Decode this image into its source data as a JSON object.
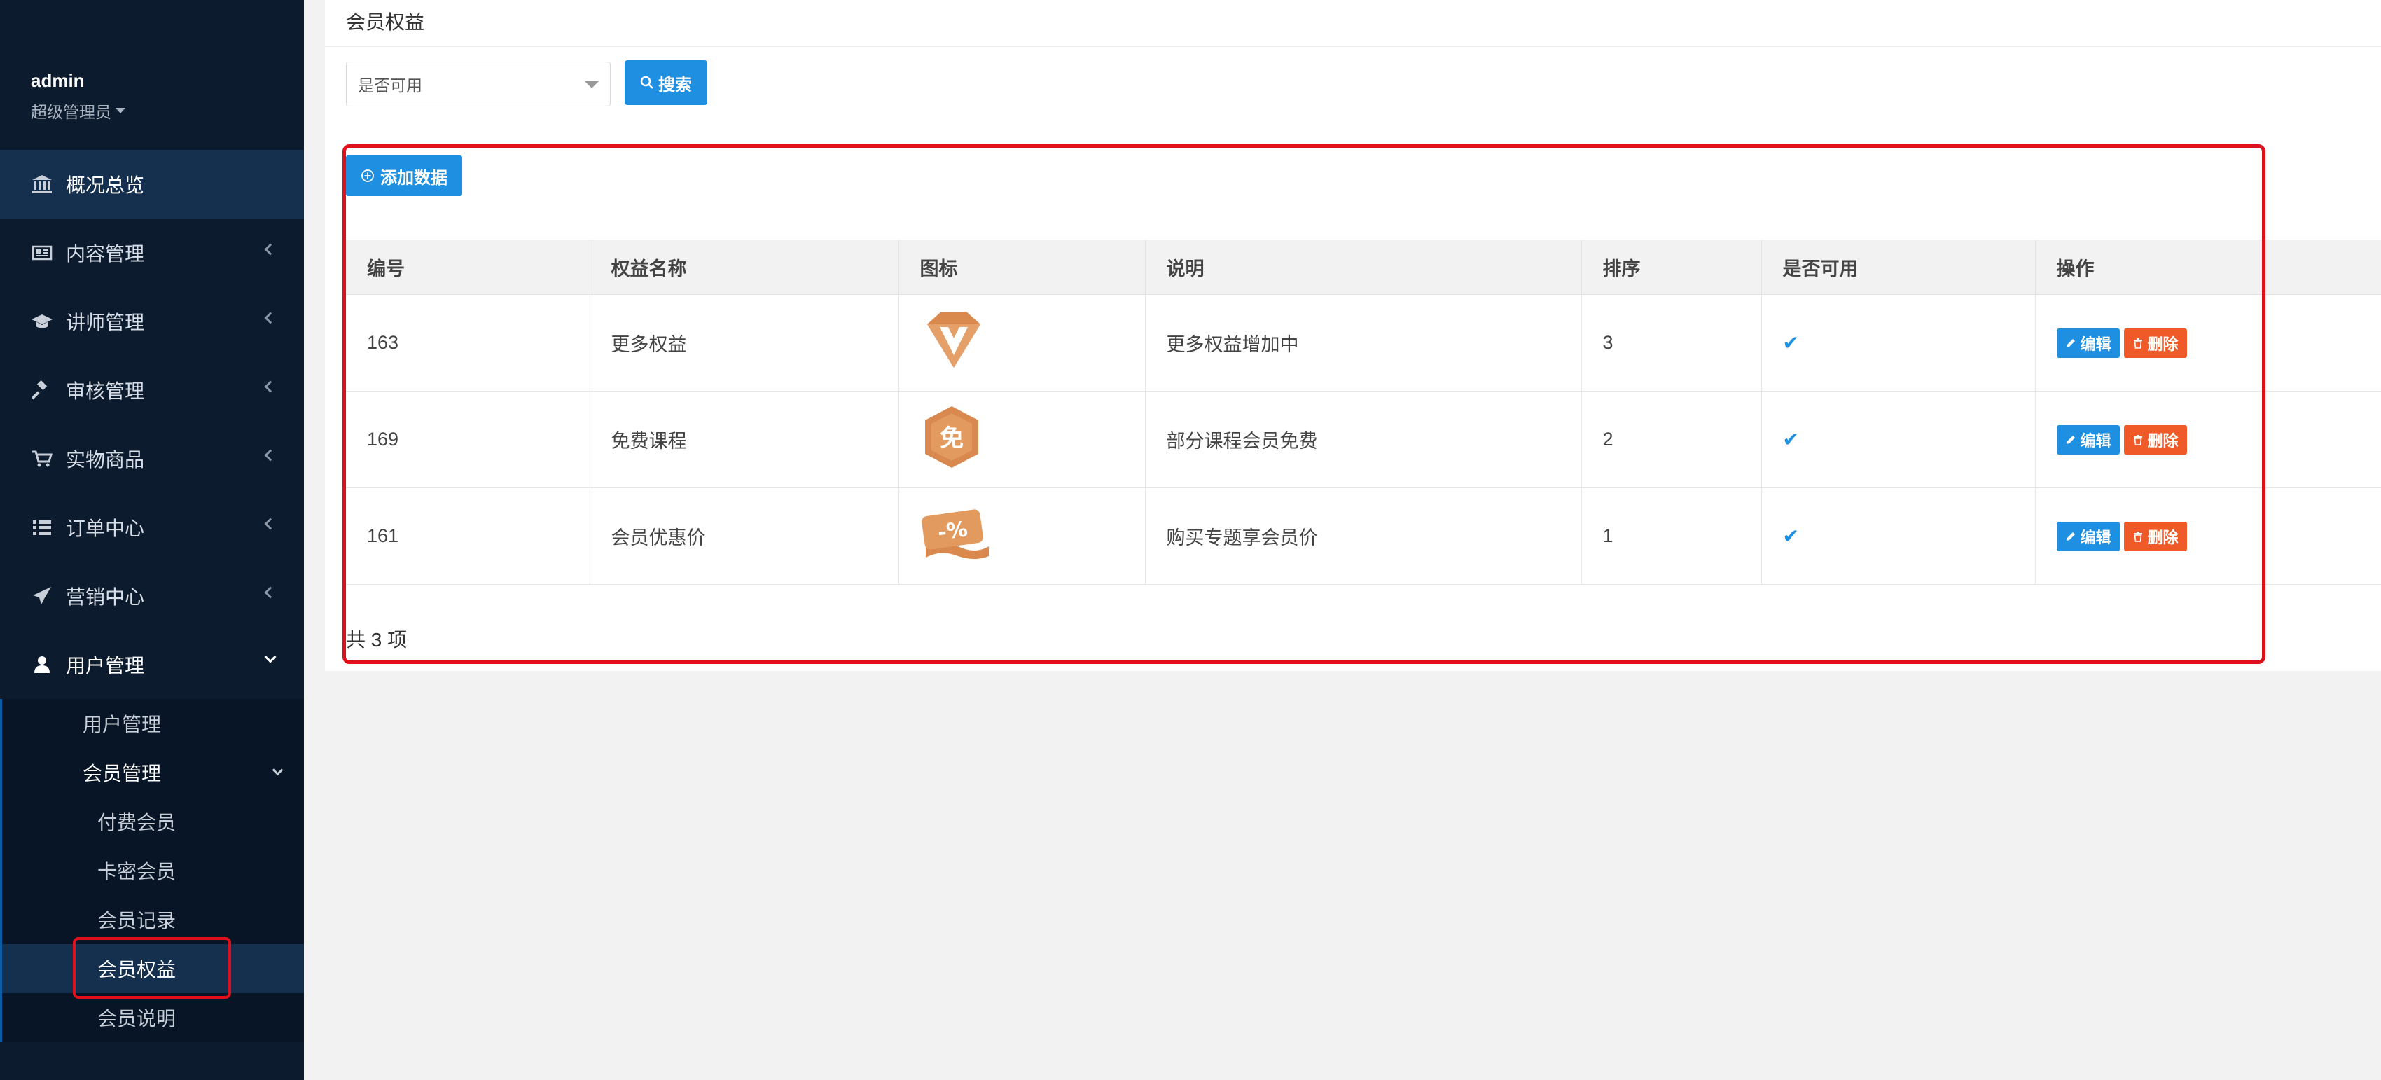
{
  "user": {
    "name": "admin",
    "role": "超级管理员"
  },
  "menu": [
    {
      "label": "概况总览",
      "icon": "bank-icon"
    },
    {
      "label": "内容管理",
      "icon": "newspaper-icon"
    },
    {
      "label": "讲师管理",
      "icon": "graduation-cap-icon"
    },
    {
      "label": "审核管理",
      "icon": "gavel-icon"
    },
    {
      "label": "实物商品",
      "icon": "cart-icon"
    },
    {
      "label": "订单中心",
      "icon": "list-icon"
    },
    {
      "label": "营销中心",
      "icon": "paper-plane-icon"
    },
    {
      "label": "用户管理",
      "icon": "user-icon"
    }
  ],
  "submenu": {
    "user_management": "用户管理",
    "member_management": "会员管理",
    "items": [
      "付费会员",
      "卡密会员",
      "会员记录",
      "会员权益",
      "会员说明"
    ]
  },
  "page": {
    "title": "会员权益",
    "filter_value": "是否可用",
    "search_label": "搜索",
    "add_label": "添加数据",
    "total": "共 3 项"
  },
  "table": {
    "headers": [
      "编号",
      "权益名称",
      "图标",
      "说明",
      "排序",
      "是否可用",
      "操作"
    ],
    "rows": [
      {
        "id": "163",
        "name": "更多权益",
        "icon": "diamond-v-icon",
        "desc": "更多权益增加中",
        "sort": "3"
      },
      {
        "id": "169",
        "name": "免费课程",
        "icon": "free-badge-icon",
        "desc": "部分课程会员免费",
        "sort": "2"
      },
      {
        "id": "161",
        "name": "会员优惠价",
        "icon": "discount-coupon-icon",
        "desc": "购买专题享会员价",
        "sort": "1"
      }
    ],
    "edit_label": "编辑",
    "delete_label": "删除"
  },
  "colors": {
    "sidebar": "#0c1b2e",
    "accent": "#1e8fe1",
    "danger": "#f05a28",
    "highlight": "#e0101b"
  }
}
